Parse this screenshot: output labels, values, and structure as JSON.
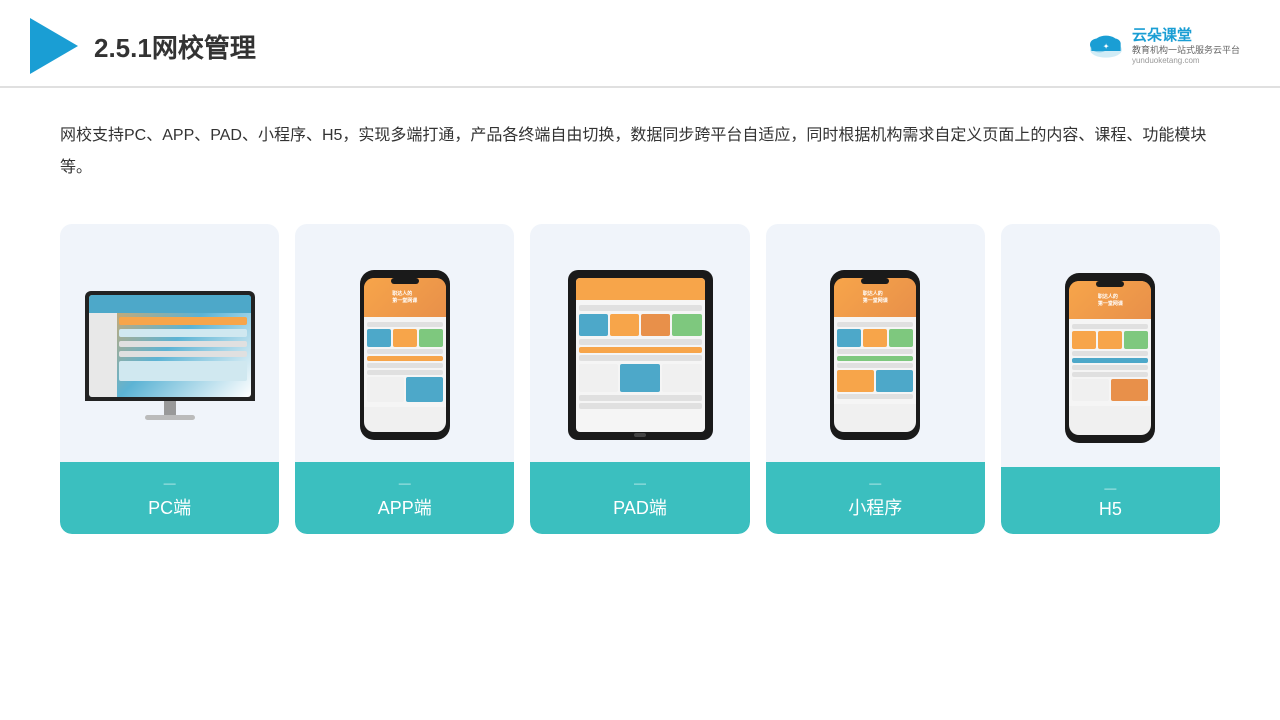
{
  "header": {
    "title": "2.5.1网校管理",
    "brand": {
      "name": "云朵课堂",
      "tagline": "教育机构一站式服务云平台",
      "url": "yunduoketang.com"
    }
  },
  "description": "网校支持PC、APP、PAD、小程序、H5，实现多端打通，产品各终端自由切换，数据同步跨平台自适应，同时根据机构需求自定义页面上的内容、课程、功能模块等。",
  "devices": [
    {
      "id": "pc",
      "label": "PC端",
      "type": "pc"
    },
    {
      "id": "app",
      "label": "APP端",
      "type": "phone"
    },
    {
      "id": "pad",
      "label": "PAD端",
      "type": "tablet"
    },
    {
      "id": "miniprogram",
      "label": "小程序",
      "type": "phone2"
    },
    {
      "id": "h5",
      "label": "H5",
      "type": "phone3"
    }
  ],
  "colors": {
    "accent": "#3bbfbf",
    "primary": "#1a9ed4",
    "bg_card": "#f0f4fa"
  }
}
